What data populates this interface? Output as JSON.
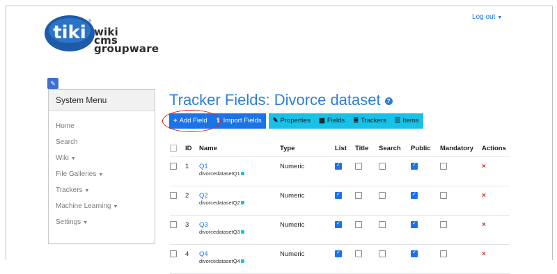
{
  "header": {
    "logout_label": "Log out",
    "logo_text": [
      "wiki",
      "cms",
      "groupware"
    ],
    "logo_brand": "tiki"
  },
  "sidebar": {
    "title": "System Menu",
    "items": [
      {
        "label": "Home"
      },
      {
        "label": "Search"
      },
      {
        "label": "Wiki",
        "dropdown": true
      },
      {
        "label": "File Galleries",
        "dropdown": true
      },
      {
        "label": "Trackers",
        "dropdown": true
      },
      {
        "label": "Machine Learning",
        "dropdown": true
      },
      {
        "label": "Settings",
        "dropdown": true
      }
    ]
  },
  "main": {
    "title": "Tracker Fields: Divorce dataset",
    "toolbar": {
      "add_field": "Add Field",
      "import_fields": "Import Fields",
      "properties": "Properties",
      "fields": "Fields",
      "trackers": "Trackers",
      "items": "Items"
    },
    "table": {
      "headers": [
        "ID",
        "Name",
        "Type",
        "List",
        "Title",
        "Search",
        "Public",
        "Mandatory",
        "Actions"
      ],
      "rows": [
        {
          "id": "1",
          "name": "Q1",
          "perm": "divorcedatasetQ1",
          "type": "Numeric",
          "list": true,
          "title": false,
          "search": false,
          "public": true,
          "mandatory": false
        },
        {
          "id": "2",
          "name": "Q2",
          "perm": "divorcedatasetQ2",
          "type": "Numeric",
          "list": true,
          "title": false,
          "search": false,
          "public": true,
          "mandatory": false
        },
        {
          "id": "3",
          "name": "Q3",
          "perm": "divorcedatasetQ3",
          "type": "Numeric",
          "list": true,
          "title": false,
          "search": false,
          "public": true,
          "mandatory": false
        },
        {
          "id": "4",
          "name": "Q4",
          "perm": "divorcedatasetQ4",
          "type": "Numeric",
          "list": true,
          "title": false,
          "search": false,
          "public": true,
          "mandatory": false
        }
      ],
      "delete_symbol": "×"
    }
  },
  "colors": {
    "link": "#1a73e8",
    "cyan": "#17c1e8",
    "title": "#2f7ed8",
    "danger": "#d62828"
  }
}
